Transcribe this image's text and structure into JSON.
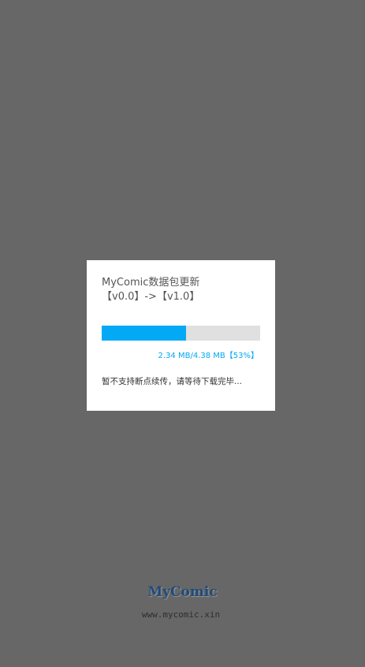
{
  "dialog": {
    "title": "MyComic数据包更新",
    "version_line": "【v0.0】->【v1.0】",
    "progress": {
      "fraction": 0.53,
      "label": "2.34 MB/4.38 MB【53%】"
    },
    "note": "暂不支持断点续传，请等待下载完毕..."
  },
  "branding": {
    "logo_text": "MyComic",
    "url": "www.mycomic.xin"
  },
  "colors": {
    "overlay_background": "#676767",
    "progress_accent": "#03a9f4",
    "progress_track": "#e0e0e0"
  }
}
